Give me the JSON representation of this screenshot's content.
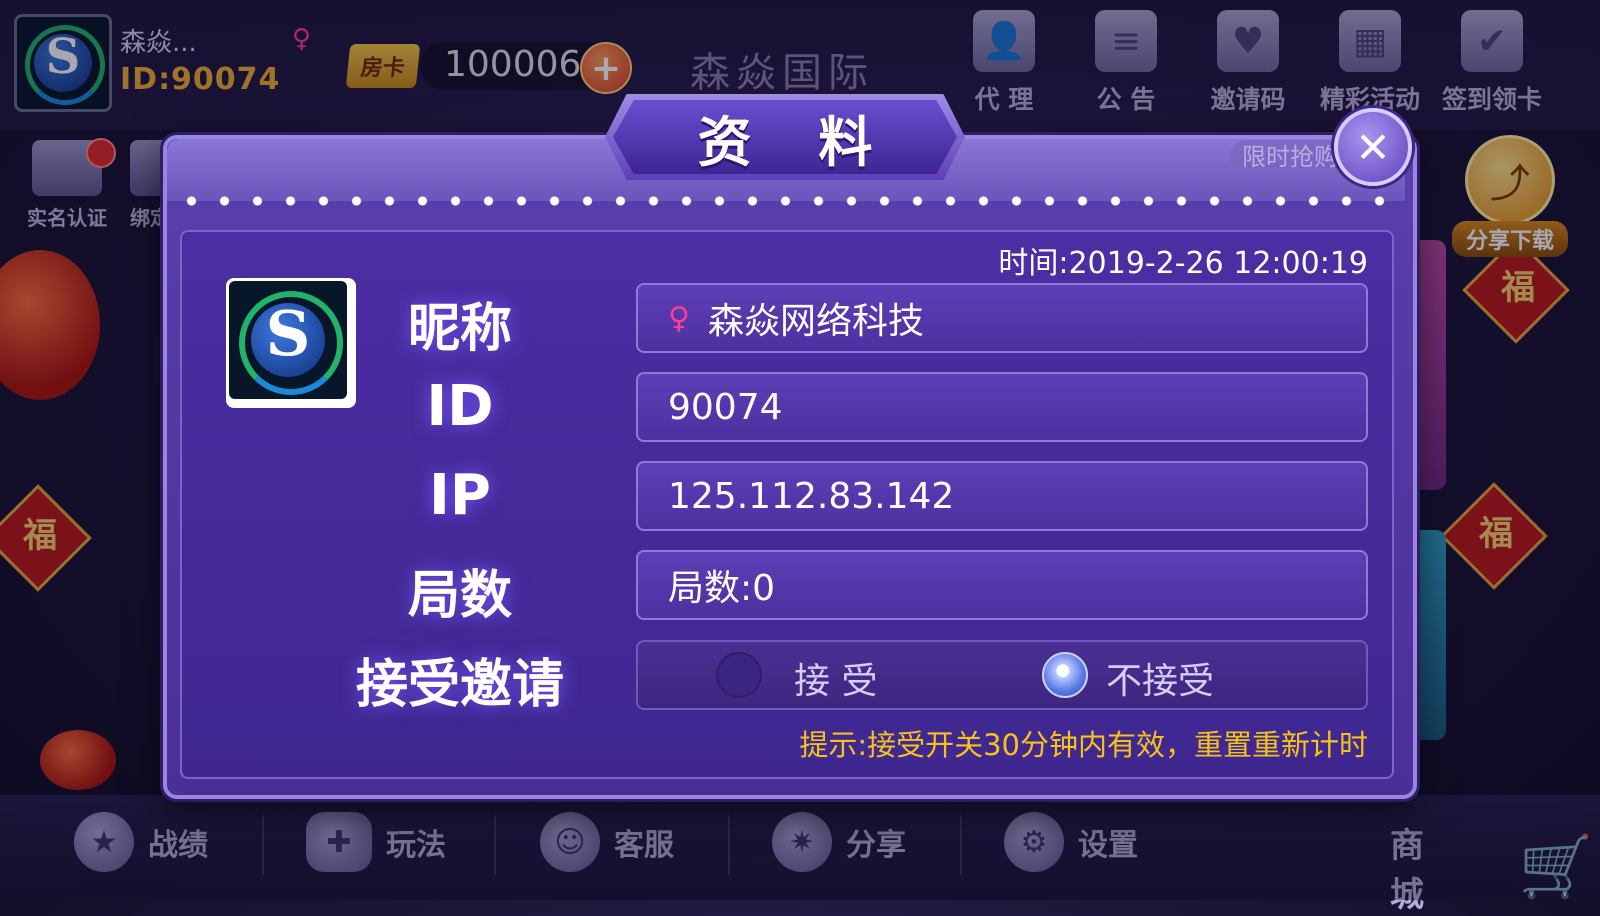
{
  "top": {
    "nickname": "森焱...",
    "user_id": "ID:90074",
    "room_card_label": "房卡",
    "room_card_count": "100006",
    "brand": "森焱国际",
    "icons": [
      {
        "label": "代 理",
        "icon": "agent-icon"
      },
      {
        "label": "公 告",
        "icon": "notice-icon"
      },
      {
        "label": "邀请码",
        "icon": "invite-code-icon"
      },
      {
        "label": "精彩活动",
        "icon": "gift-icon"
      },
      {
        "label": "签到领卡",
        "icon": "checkin-icon"
      }
    ]
  },
  "side": {
    "realname_label": "实名认证",
    "bind_label": "绑定",
    "limited_label": "限时抢购",
    "share_download_label": "分享下载"
  },
  "dialog": {
    "title": "资 料",
    "close_icon": "close-icon",
    "time": "时间:2019-2-26 12:00:19",
    "labels": {
      "nickname": "昵称",
      "id": "ID",
      "ip": "IP",
      "rounds": "局数",
      "accept_invite": "接受邀请"
    },
    "values": {
      "nickname": "森焱网络科技",
      "id": "90074",
      "ip": "125.112.83.142",
      "rounds": "局数:0"
    },
    "accept_option": "接 受",
    "reject_option": "不接受",
    "selected": "不接受",
    "hint": "提示:接受开关30分钟内有效，重置重新计时"
  },
  "bottom_nav": [
    {
      "label": "战绩",
      "icon": "record-icon"
    },
    {
      "label": "玩法",
      "icon": "gamepad-icon"
    },
    {
      "label": "客服",
      "icon": "support-icon"
    },
    {
      "label": "分享",
      "icon": "share-icon"
    },
    {
      "label": "设置",
      "icon": "settings-icon"
    }
  ],
  "shop_label": "商 城",
  "colors": {
    "dialog_bg": "#4b2ea3",
    "accent_gold": "#f0b030",
    "hint_yellow": "#f5c21c",
    "female_pink": "#ff3a9a"
  }
}
